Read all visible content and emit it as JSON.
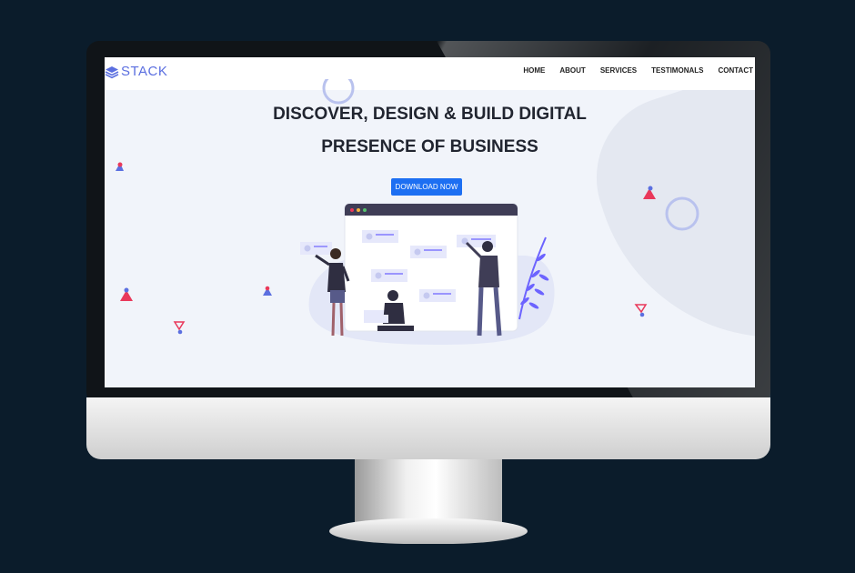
{
  "brand": {
    "name": "STACK",
    "color": "#5b6fe0",
    "icon": "stack-layers-icon"
  },
  "nav": {
    "items": [
      "HOME",
      "ABOUT",
      "SERVICES",
      "TESTIMONALS",
      "CONTACT"
    ]
  },
  "hero": {
    "title_line1": "DISCOVER, DESIGN & BUILD DIGITAL",
    "title_line2": "PRESENCE OF BUSINESS",
    "cta_label": "DOWNLOAD NOW",
    "cta_color": "#1d6ff2"
  },
  "illustration": {
    "name": "team-building-website-illustration"
  },
  "colors": {
    "background": "#0b1c2b",
    "screen_bg": "#f1f4fa",
    "accent_red": "#e9385a",
    "accent_blue": "#5b6fe0"
  }
}
